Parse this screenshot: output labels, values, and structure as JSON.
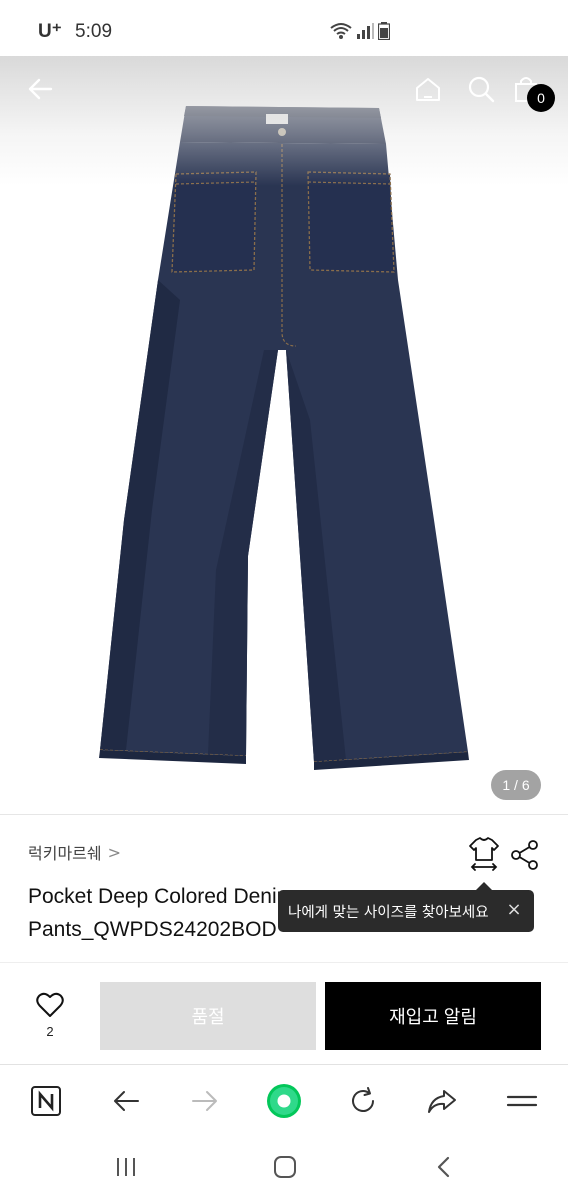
{
  "status_bar": {
    "carrier": "U⁺",
    "time": "5:09",
    "icons": [
      "wifi-icon",
      "signal-icon",
      "battery-icon"
    ]
  },
  "header": {
    "back_icon": "arrow-left-icon",
    "home_icon": "home-icon",
    "search_icon": "search-icon",
    "cart_icon": "shopping-bag-icon",
    "cart_count": "0"
  },
  "gallery": {
    "page_indicator": "1 / 6",
    "image_colors": {
      "denim": "#2a3552",
      "denim_dark": "#1d2740",
      "stitch": "#8a6e4b"
    }
  },
  "product": {
    "brand": "럭키마르쉐",
    "brand_chevron": ">",
    "title": "Pocket Deep Colored Denim Pants_QWPDS24202BOD",
    "size_tooltip": "나에게 맞는 사이즈를 찾아보세요",
    "tooltip_close": "×"
  },
  "purchase": {
    "like_count": "2",
    "soldout_label": "품절",
    "restock_label": "재입고 알림"
  },
  "browser_nav": {
    "icons": [
      "naver-n-icon",
      "back-arrow-icon",
      "forward-arrow-icon",
      "green-dot-icon",
      "refresh-icon",
      "share-forward-icon",
      "menu-icon"
    ],
    "naver_letter": "N"
  },
  "system_nav": {
    "icons": [
      "recent-apps-icon",
      "home-circle-icon",
      "back-chevron-icon"
    ]
  },
  "colors": {
    "accent_green": "#03c75a",
    "black": "#000000",
    "soldout_gray": "#dedede"
  }
}
